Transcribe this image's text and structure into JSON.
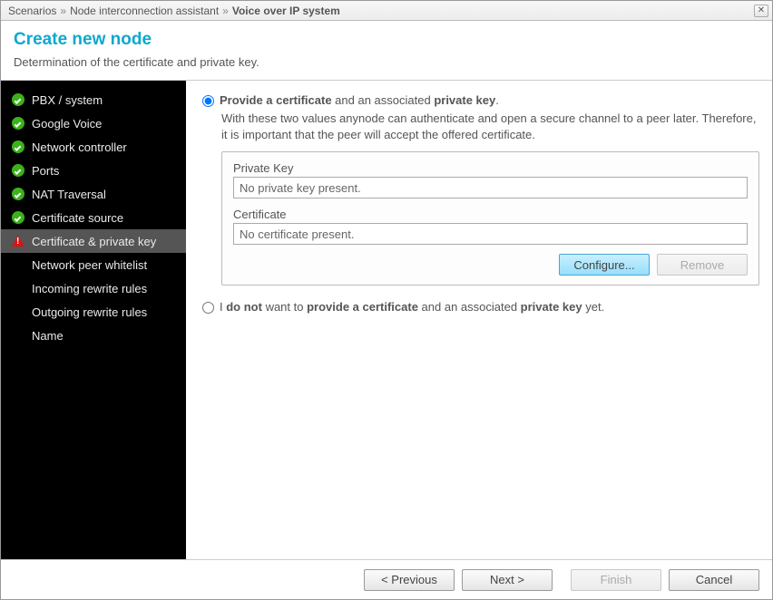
{
  "titlebar": {
    "crumb1": "Scenarios",
    "crumb2": "Node interconnection assistant",
    "crumb3": "Voice over IP system",
    "sep": "»"
  },
  "header": {
    "title": "Create new node",
    "subtitle": "Determination of the certificate and private key."
  },
  "sidebar": {
    "items": [
      {
        "label": "PBX / system",
        "status": "ok",
        "selected": false
      },
      {
        "label": "Google Voice",
        "status": "ok",
        "selected": false
      },
      {
        "label": "Network controller",
        "status": "ok",
        "selected": false
      },
      {
        "label": "Ports",
        "status": "ok",
        "selected": false
      },
      {
        "label": "NAT Traversal",
        "status": "ok",
        "selected": false
      },
      {
        "label": "Certificate source",
        "status": "ok",
        "selected": false
      },
      {
        "label": "Certificate & private key",
        "status": "warn",
        "selected": true
      },
      {
        "label": "Network peer whitelist",
        "status": "none",
        "selected": false
      },
      {
        "label": "Incoming rewrite rules",
        "status": "none",
        "selected": false
      },
      {
        "label": "Outgoing rewrite rules",
        "status": "none",
        "selected": false
      },
      {
        "label": "Name",
        "status": "none",
        "selected": false
      }
    ]
  },
  "options": {
    "selected": "provide",
    "provide": {
      "label_part1": "Provide a certificate",
      "label_part2": " and an associated ",
      "label_part3": "private key",
      "label_part4": ".",
      "description": "With these two values anynode can authenticate and open a secure channel to a peer later. Therefore, it is important that the peer will accept the offered certificate.",
      "privkey_label": "Private Key",
      "privkey_value": "No private key present.",
      "cert_label": "Certificate",
      "cert_value": "No certificate present.",
      "configure_btn": "Configure...",
      "remove_btn": "Remove"
    },
    "skip": {
      "label_part1": "I ",
      "label_part2": "do not",
      "label_part3": " want to ",
      "label_part4": "provide a certificate",
      "label_part5": " and an associated ",
      "label_part6": "private key",
      "label_part7": " yet."
    }
  },
  "footer": {
    "prev": "< Previous",
    "next": "Next >",
    "finish": "Finish",
    "cancel": "Cancel"
  }
}
